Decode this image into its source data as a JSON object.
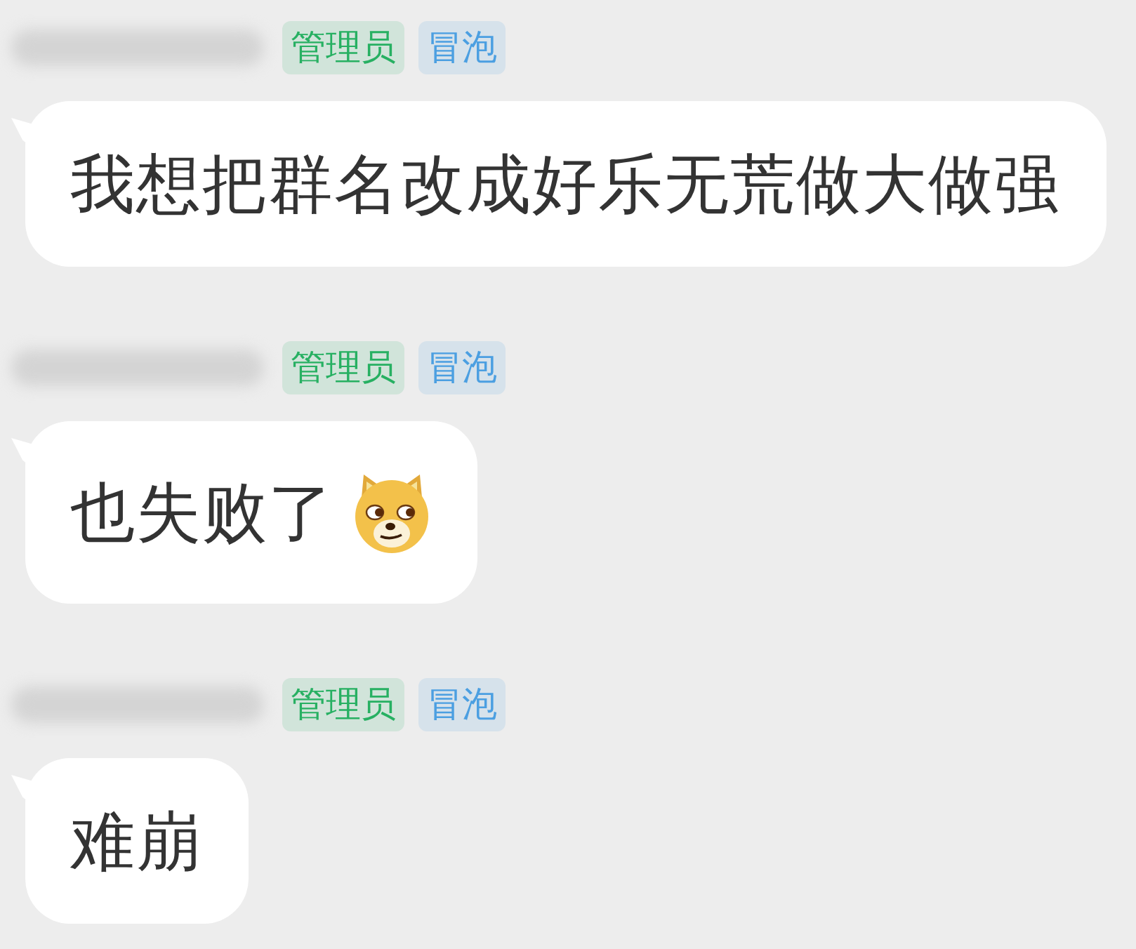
{
  "messages": [
    {
      "badges": [
        {
          "label": "管理员",
          "color": "#27b062"
        },
        {
          "label": "冒泡",
          "color": "#4b9fe1"
        }
      ],
      "text": "我想把群名改成好乐无荒做大做强",
      "emoji": false
    },
    {
      "badges": [
        {
          "label": "管理员",
          "color": "#27b062"
        },
        {
          "label": "冒泡",
          "color": "#4b9fe1"
        }
      ],
      "text": "也失败了",
      "emoji": true
    },
    {
      "badges": [
        {
          "label": "管理员",
          "color": "#27b062"
        },
        {
          "label": "冒泡",
          "color": "#4b9fe1"
        }
      ],
      "text": "难崩",
      "emoji": false
    }
  ]
}
